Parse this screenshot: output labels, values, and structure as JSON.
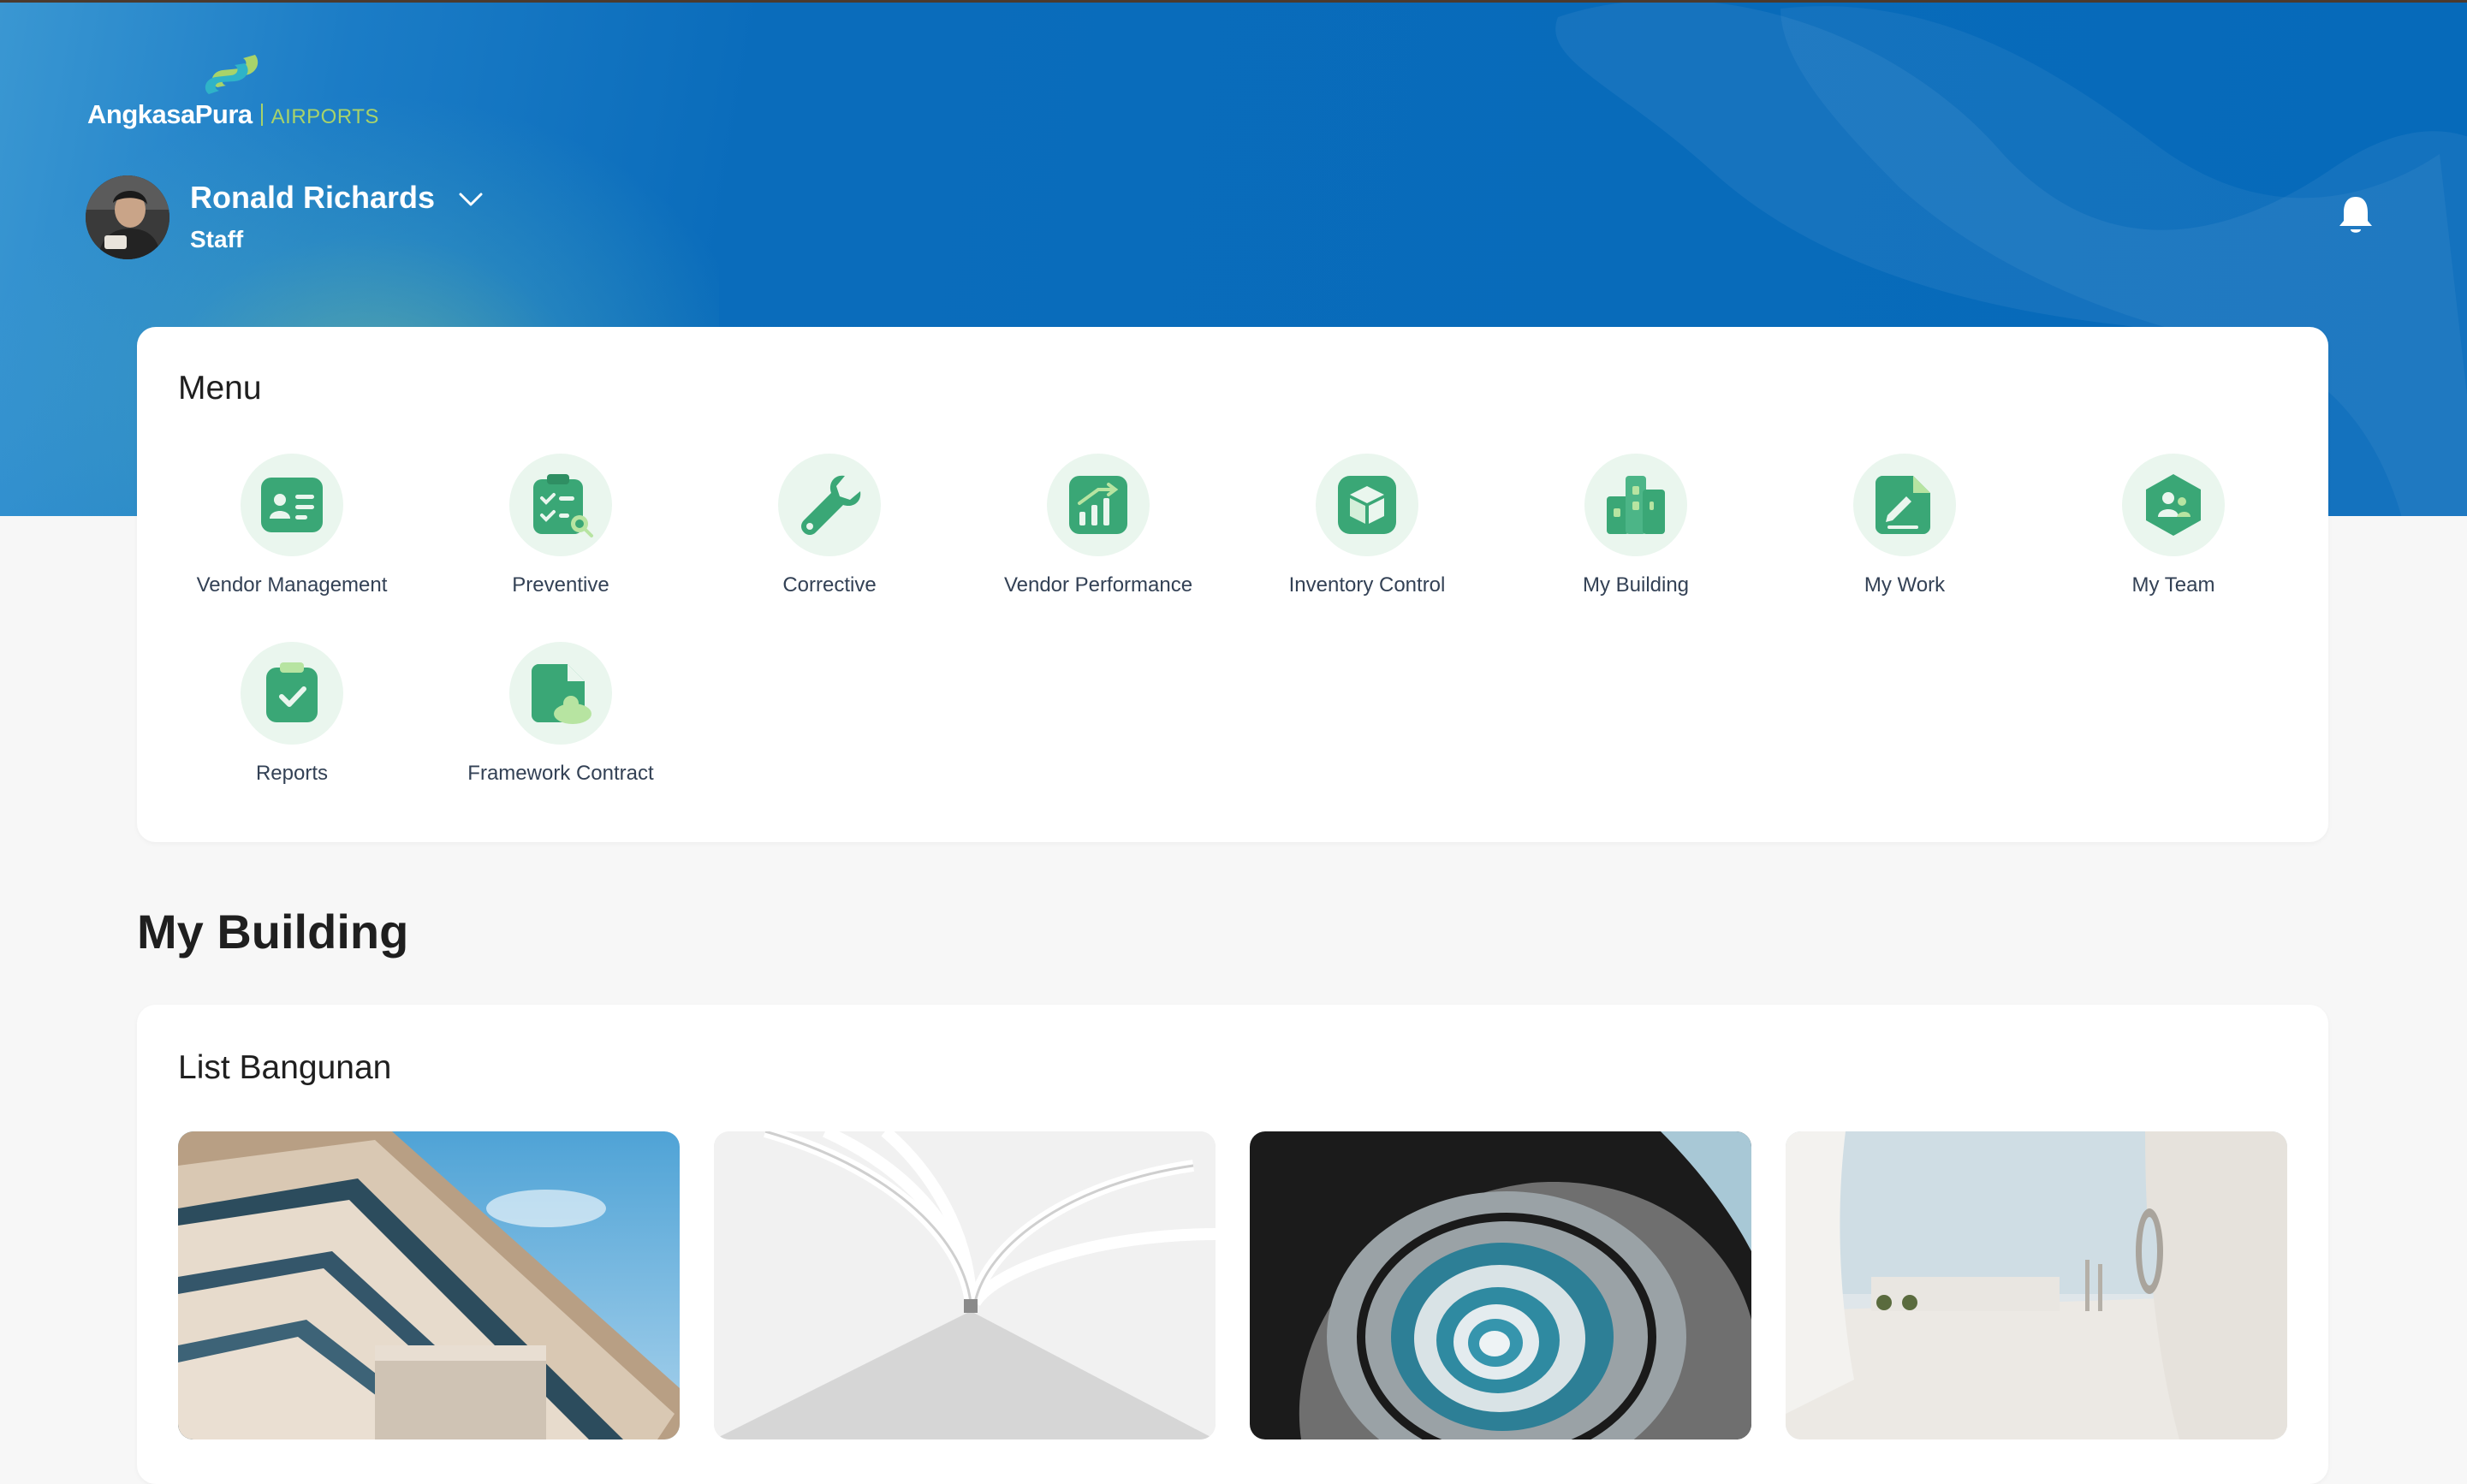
{
  "brand": {
    "name": "AngkasaPura",
    "sub": "AIRPORTS",
    "colors": {
      "primary": "#066aba",
      "accent": "#a8d36a",
      "icon_green": "#3aa776",
      "icon_bg": "#eaf6ee"
    }
  },
  "user": {
    "name": "Ronald Richards",
    "role": "Staff"
  },
  "menu": {
    "title": "Menu",
    "items": [
      {
        "label": "Vendor Management",
        "icon": "vendor-card-icon"
      },
      {
        "label": "Preventive",
        "icon": "checklist-icon"
      },
      {
        "label": "Corrective",
        "icon": "wrench-icon"
      },
      {
        "label": "Vendor Performance",
        "icon": "chart-up-icon"
      },
      {
        "label": "Inventory Control",
        "icon": "box-icon"
      },
      {
        "label": "My Building",
        "icon": "building-icon"
      },
      {
        "label": "My Work",
        "icon": "document-edit-icon"
      },
      {
        "label": "My Team",
        "icon": "team-icon"
      },
      {
        "label": "Reports",
        "icon": "clipboard-check-icon"
      },
      {
        "label": "Framework Contract",
        "icon": "contract-icon"
      }
    ]
  },
  "my_building": {
    "title": "My Building",
    "list_title": "List Bangunan",
    "buildings": [
      {
        "image": "modern-facade-photo"
      },
      {
        "image": "white-corridor-photo"
      },
      {
        "image": "spiral-tunnel-photo"
      },
      {
        "image": "white-plaza-photo"
      }
    ]
  }
}
